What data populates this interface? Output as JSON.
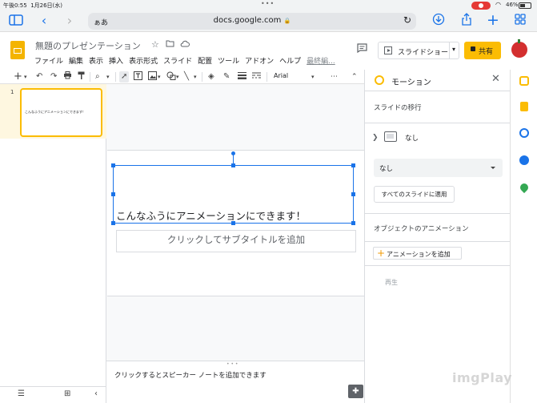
{
  "status_bar": {
    "time": "午後0:55",
    "date": "1月26日(水)",
    "battery": "46%"
  },
  "browser": {
    "aa_label": "ぁあ",
    "url": "docs.google.com",
    "lock": "🔒"
  },
  "app": {
    "doc_title": "無題のプレゼンテーション",
    "menu": [
      "ファイル",
      "編集",
      "表示",
      "挿入",
      "表示形式",
      "スライド",
      "配置",
      "ツール",
      "アドオン",
      "ヘルプ",
      "最終編..."
    ],
    "slideshow_label": "スライドショー",
    "share_label": "共有"
  },
  "toolbar": {
    "font": "Arial"
  },
  "filmstrip": {
    "slide_number": "1",
    "thumb_text": "こんなふうにアニメーションにできます！"
  },
  "slide": {
    "title": "こんなふうにアニメーションにできます！",
    "subtitle_placeholder": "クリックしてサブタイトルを追加"
  },
  "notes": {
    "placeholder": "クリックするとスピーカー ノートを追加できます"
  },
  "panel": {
    "title": "モーション",
    "transition_section": "スライドの移行",
    "transition_name": "なし",
    "dropdown_value": "なし",
    "apply_all": "すべてのスライドに適用",
    "object_section": "オブジェクトのアニメーション",
    "add_animation": "アニメーションを追加",
    "play": "再生"
  },
  "watermark": "imgPlay",
  "colors": {
    "accent": "#1a73e8",
    "share": "#fbbc04",
    "slides_logo": "#f4b400"
  }
}
